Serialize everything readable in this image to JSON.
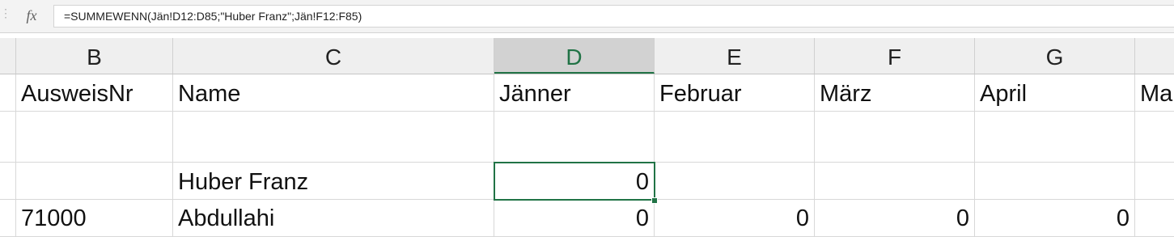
{
  "formula_bar": {
    "fx_label": "fx",
    "formula": "=SUMMEWENN(Jän!D12:D85;\"Huber Franz\";Jän!F12:F85)"
  },
  "columns": [
    {
      "id": "",
      "label": ""
    },
    {
      "id": "B",
      "label": "B"
    },
    {
      "id": "C",
      "label": "C"
    },
    {
      "id": "D",
      "label": "D",
      "selected": true
    },
    {
      "id": "E",
      "label": "E"
    },
    {
      "id": "F",
      "label": "F"
    },
    {
      "id": "G",
      "label": "G"
    },
    {
      "id": "H",
      "label": ""
    }
  ],
  "rows": [
    {
      "B": "AusweisNr",
      "C": "Name",
      "D": "Jänner",
      "E": "Februar",
      "F": "März",
      "G": "April",
      "H": "Ma"
    },
    {
      "B": "",
      "C": "",
      "D": "",
      "E": "",
      "F": "",
      "G": "",
      "H": ""
    },
    {
      "B": "",
      "C": "Huber Franz",
      "D": "0",
      "E": "",
      "F": "",
      "G": "",
      "H": ""
    },
    {
      "B": "71000",
      "C": "Abdullahi",
      "D": "0",
      "E": "0",
      "F": "0",
      "G": "0",
      "H": ""
    }
  ],
  "active_cell": {
    "column": "D",
    "value": "0"
  }
}
